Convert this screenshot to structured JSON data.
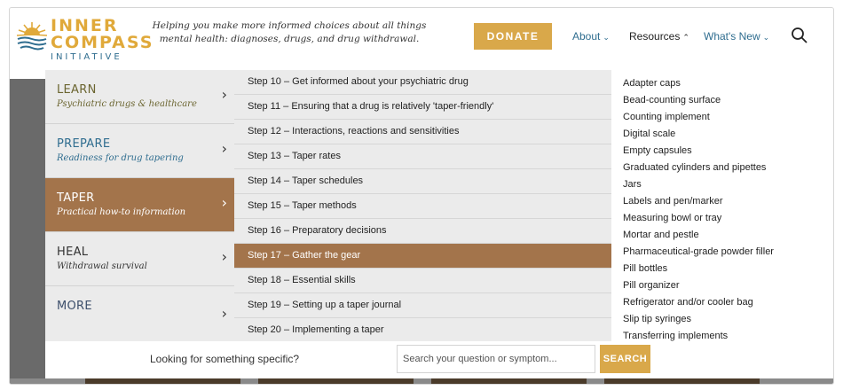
{
  "brand": {
    "line1": "INNER",
    "line2": "COMPASS",
    "line3": "INITIATIVE",
    "tagline": "Helping you make more informed choices about all things mental health: diagnoses, drugs, and drug withdrawal.",
    "colors": {
      "gold": "#d9a84a",
      "blue": "#2f6d8f",
      "brown": "#a3744b"
    }
  },
  "header": {
    "donate_label": "DONATE",
    "nav": [
      {
        "label": "About",
        "chevron": "⌄"
      },
      {
        "label": "Resources",
        "chevron": "^"
      },
      {
        "label": "What's New",
        "chevron": "⌄"
      }
    ],
    "search_icon": "search-icon"
  },
  "menu": {
    "sections": [
      {
        "title": "LEARN",
        "subtitle": "Psychiatric drugs & healthcare",
        "arrow": "›"
      },
      {
        "title": "PREPARE",
        "subtitle": "Readiness for drug tapering",
        "arrow": "›"
      },
      {
        "title": "TAPER",
        "subtitle": "Practical how-to information",
        "arrow": "›"
      },
      {
        "title": "HEAL",
        "subtitle": "Withdrawal survival",
        "arrow": "›"
      },
      {
        "title": "MORE",
        "subtitle": "",
        "arrow": "›"
      }
    ],
    "active_section": "TAPER",
    "steps": [
      "Step 10 – Get informed about your psychiatric drug",
      "Step 11 – Ensuring that a drug is relatively 'taper-friendly'",
      "Step 12 – Interactions, reactions and sensitivities",
      "Step 13 – Taper rates",
      "Step 14 – Taper schedules",
      "Step 15 – Taper methods",
      "Step 16 – Preparatory decisions",
      "Step 17 – Gather the gear",
      "Step 18 – Essential skills",
      "Step 19 – Setting up a taper journal",
      "Step 20 – Implementing a taper"
    ],
    "active_step": "Step 17 – Gather the gear",
    "gear_items": [
      "Adapter caps",
      "Bead-counting surface",
      "Counting implement",
      "Digital scale",
      "Empty capsules",
      "Graduated cylinders and pipettes",
      "Jars",
      "Labels and pen/marker",
      "Measuring bowl or tray",
      "Mortar and pestle",
      "Pharmaceutical-grade powder filler",
      "Pill bottles",
      "Pill organizer",
      "Refrigerator and/or cooler bag",
      "Slip tip syringes",
      "Transferring implements"
    ]
  },
  "search": {
    "label": "Looking for something specific?",
    "placeholder": "Search your question or symptom...",
    "button_label": "SEARCH"
  }
}
